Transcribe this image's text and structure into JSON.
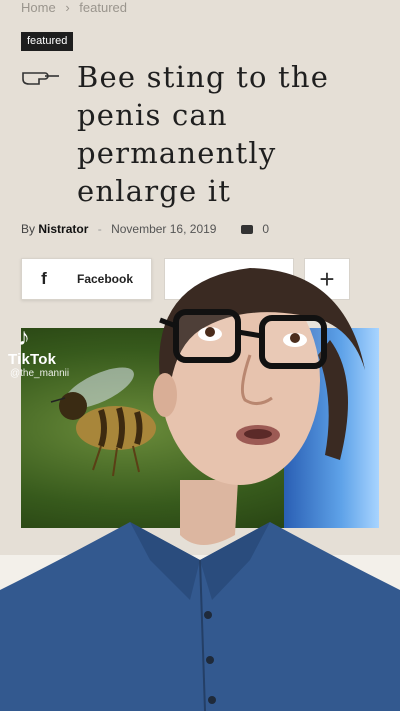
{
  "breadcrumb": {
    "home": "Home",
    "separator": "›",
    "current": "featured"
  },
  "tag": "featured",
  "headline": "Bee sting to the penis can permanently enlarge it",
  "meta": {
    "by": "By",
    "author": "Nistrator",
    "separator": "-",
    "date": "November 16, 2019",
    "comment_count": "0",
    "comment_icon": "comment-icon"
  },
  "share": {
    "facebook_icon": "f",
    "facebook_label": "Facebook",
    "more_symbol": "+"
  },
  "tiktok": {
    "mark": "♪",
    "name": "TikTok",
    "handle": "@the_mannii"
  },
  "colors": {
    "page_bg": "#e5dfd6",
    "tag_bg": "#1e1e1e",
    "text": "#1f1f1f",
    "shirt": "#33598f"
  }
}
